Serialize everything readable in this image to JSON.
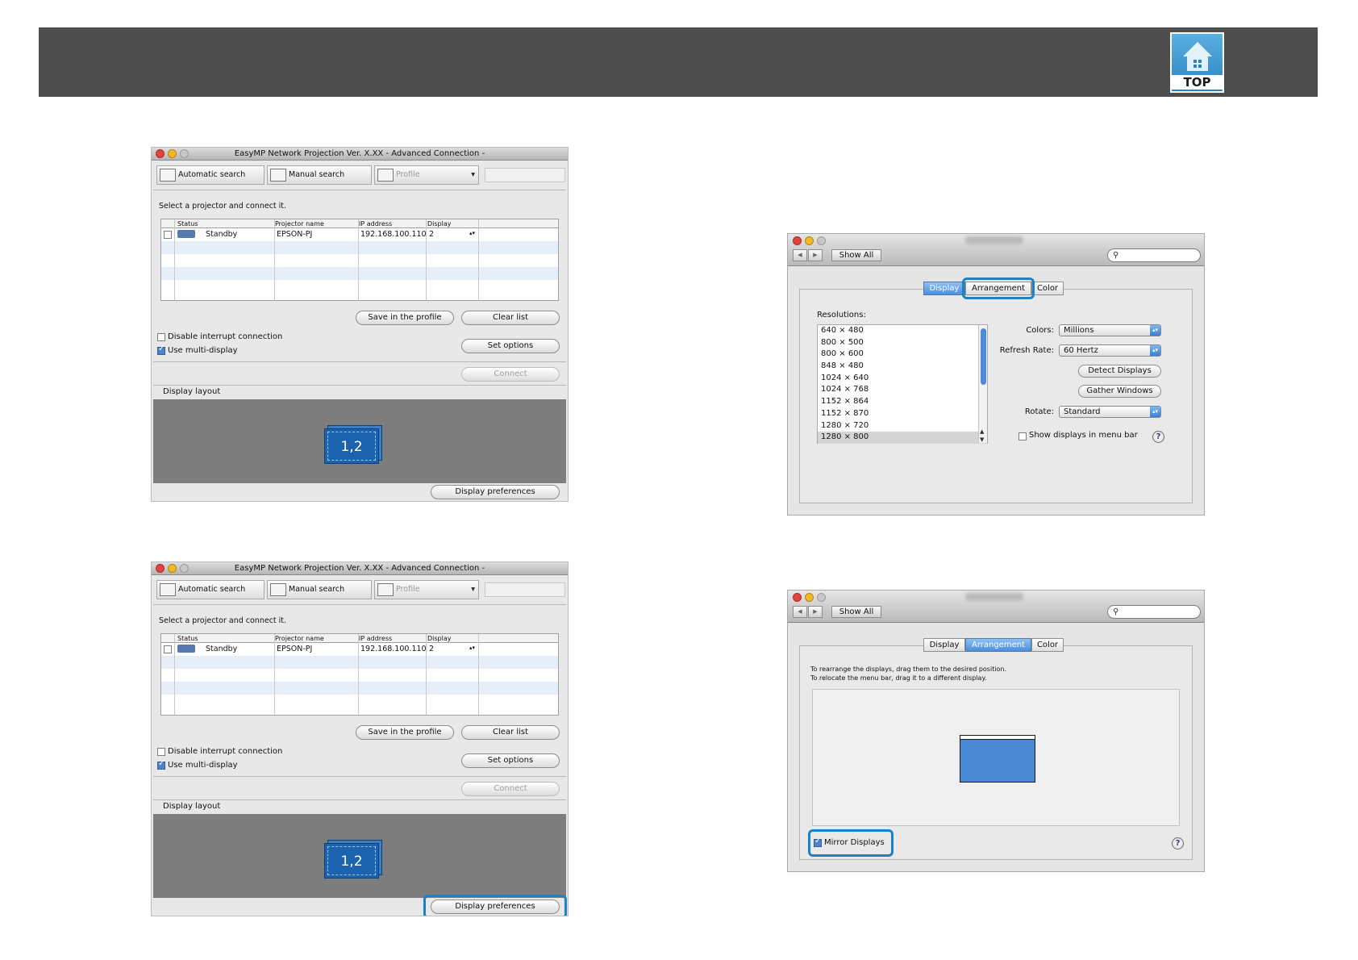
{
  "banner": {
    "top_label": "TOP"
  },
  "emp_windows": [
    {
      "title": "EasyMP Network Projection Ver. X.XX - Advanced Connection -",
      "toolbar": {
        "auto": "Automatic search",
        "manual": "Manual search",
        "profile": "Profile"
      },
      "prompt": "Select a projector and connect it.",
      "columns": [
        "Status",
        "Projector name",
        "IP address",
        "Display"
      ],
      "row": {
        "status": "Standby",
        "name": "EPSON-PJ",
        "ip": "192.168.100.110",
        "display": "2"
      },
      "buttons": {
        "save": "Save in the profile",
        "clear": "Clear list",
        "set": "Set options",
        "connect": "Connect",
        "prefs": "Display preferences"
      },
      "checks": {
        "interrupt": "Disable interrupt connection",
        "multi": "Use multi-display"
      },
      "layout_label": "Display layout",
      "card": "1,2"
    },
    {
      "title": "EasyMP Network Projection Ver. X.XX - Advanced Connection -",
      "toolbar": {
        "auto": "Automatic search",
        "manual": "Manual search",
        "profile": "Profile"
      },
      "prompt": "Select a projector and connect it.",
      "columns": [
        "Status",
        "Projector name",
        "IP address",
        "Display"
      ],
      "row": {
        "status": "Standby",
        "name": "EPSON-PJ",
        "ip": "192.168.100.110",
        "display": "2"
      },
      "buttons": {
        "save": "Save in the profile",
        "clear": "Clear list",
        "set": "Set options",
        "connect": "Connect",
        "prefs": "Display preferences"
      },
      "checks": {
        "interrupt": "Disable interrupt connection",
        "multi": "Use multi-display"
      },
      "layout_label": "Display layout",
      "card": "1,2"
    }
  ],
  "mac_display": {
    "show_all": "Show All",
    "tabs": [
      "Display",
      "Arrangement",
      "Color"
    ],
    "resolutions_label": "Resolutions:",
    "resolutions": [
      "640 × 480",
      "800 × 500",
      "800 × 600",
      "848 × 480",
      "1024 × 640",
      "1024 × 768",
      "1152 × 864",
      "1152 × 870",
      "1280 × 720",
      "1280 × 800"
    ],
    "colors_label": "Colors:",
    "colors_value": "Millions",
    "refresh_label": "Refresh Rate:",
    "refresh_value": "60 Hertz",
    "detect": "Detect Displays",
    "gather": "Gather Windows",
    "rotate_label": "Rotate:",
    "rotate_value": "Standard",
    "menu_bar": "Show displays in menu bar",
    "help": "?"
  },
  "mac_arrangement": {
    "show_all": "Show All",
    "tabs": [
      "Display",
      "Arrangement",
      "Color"
    ],
    "instruction_1": "To rearrange the displays, drag them to the desired position.",
    "instruction_2": "To relocate the menu bar, drag it to a different display.",
    "mirror": "Mirror Displays",
    "help": "?"
  },
  "colors": {
    "banner": "#4d4d4d",
    "highlight": "#1b82c6",
    "card": "#1b63ae"
  }
}
